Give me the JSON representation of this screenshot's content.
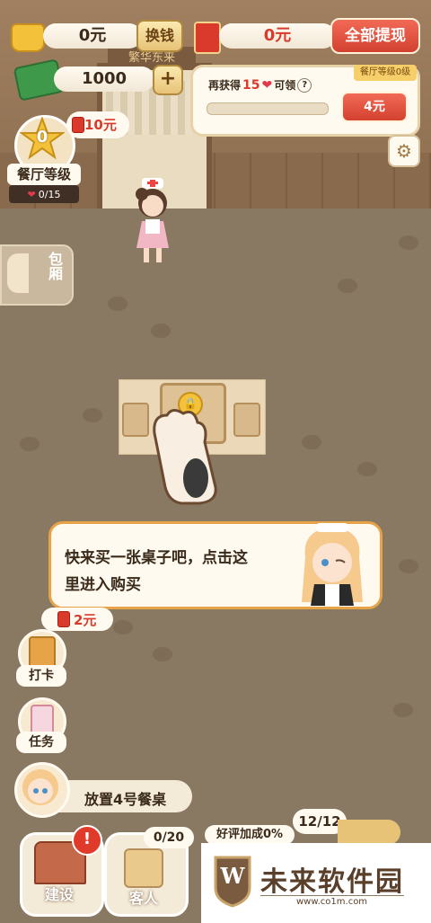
{
  "top": {
    "coins": "0元",
    "exchange_label": "换钱",
    "redpacket_amount": "0元",
    "withdraw_all_label": "全部提现",
    "cash": "1000",
    "plus_label": "+"
  },
  "reward_panel": {
    "prefix": "再获得",
    "count": "15",
    "suffix": "可领",
    "level_tag": "餐厅等级0级",
    "progress": 0,
    "reward_amount": "4元"
  },
  "level": {
    "number": "0",
    "red_packet": "10元",
    "label": "餐厅等级",
    "hearts": "0/15"
  },
  "sign_text": "繁华东来",
  "private_room_label": "包厢",
  "tutorial": {
    "line1": "快来买一张桌子吧，点击这",
    "line2": "里进入购买"
  },
  "side": {
    "checkin_red_packet": "2元",
    "checkin_label": "打卡",
    "task_label": "任务",
    "place_table": "放置4号餐桌"
  },
  "bottom": {
    "build_label": "建设",
    "customer_label": "客人",
    "customer_count": "0/20",
    "rating_bonus": "好评加成0%",
    "capacity": "12/12"
  },
  "watermark": {
    "brand": "未来软件园",
    "url": "www.co1m.com",
    "logo_letter": "W"
  },
  "colors": {
    "accent_red": "#d93a2b",
    "panel": "#fffaf0",
    "border_orange": "#e7a347"
  }
}
